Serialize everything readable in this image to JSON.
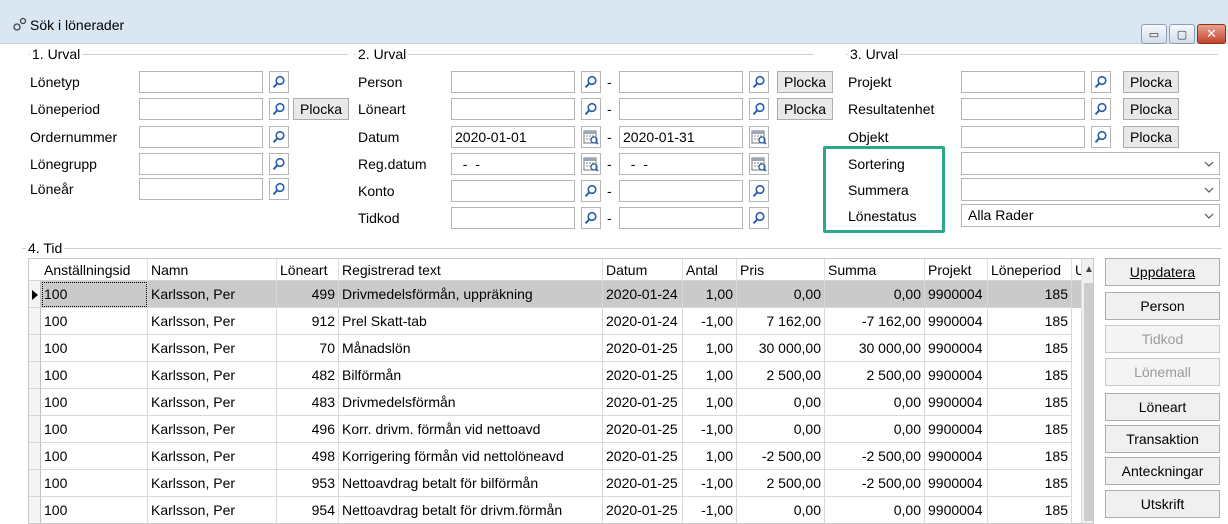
{
  "window": {
    "title": "Sök i lönerader",
    "icon": "users-icon",
    "controls": [
      "minimize-icon",
      "maximize-icon",
      "close-icon"
    ]
  },
  "urval1": {
    "label": "1. Urval",
    "fields": [
      {
        "label": "Lönetyp",
        "value": ""
      },
      {
        "label": "Löneperiod",
        "value": "",
        "pick": "Plocka"
      },
      {
        "label": "Ordernummer",
        "value": ""
      },
      {
        "label": "Lönegrupp",
        "value": ""
      },
      {
        "label": "Löneår",
        "value": ""
      }
    ]
  },
  "urval2": {
    "label": "2. Urval",
    "fields": [
      {
        "label": "Person",
        "from": "",
        "to": "",
        "pick": "Plocka"
      },
      {
        "label": "Löneart",
        "from": "",
        "to": "",
        "pick": "Plocka"
      },
      {
        "label": "Datum",
        "from": "2020-01-01",
        "to": "2020-01-31"
      },
      {
        "label": "Reg.datum",
        "from": "  -  -",
        "to": "  -  -"
      },
      {
        "label": "Konto",
        "from": "",
        "to": ""
      },
      {
        "label": "Tidkod",
        "from": "",
        "to": ""
      }
    ],
    "dash": "-"
  },
  "urval3": {
    "label": "3. Urval",
    "fields": [
      {
        "label": "Projekt",
        "value": "",
        "pick": "Plocka"
      },
      {
        "label": "Resultatenhet",
        "value": "",
        "pick": "Plocka"
      },
      {
        "label": "Objekt",
        "value": "",
        "pick": "Plocka"
      }
    ],
    "combos": [
      {
        "label": "Sortering",
        "value": ""
      },
      {
        "label": "Summera",
        "value": ""
      },
      {
        "label": "Lönestatus",
        "value": "Alla Rader"
      }
    ]
  },
  "tid": {
    "label": "4. Tid",
    "columns": [
      "Anställningsid",
      "Namn",
      "Löneart",
      "Registrerad text",
      "Datum",
      "Antal",
      "Pris",
      "Summa",
      "Projekt",
      "Löneperiod",
      "U"
    ],
    "rows": [
      [
        "100",
        "Karlsson, Per",
        "499",
        "Drivmedelsförmån, uppräkning",
        "2020-01-24",
        "1,00",
        "0,00",
        "0,00",
        "9900004",
        "185"
      ],
      [
        "100",
        "Karlsson, Per",
        "912",
        "Prel Skatt-tab",
        "2020-01-24",
        "-1,00",
        "7 162,00",
        "-7 162,00",
        "9900004",
        "185"
      ],
      [
        "100",
        "Karlsson, Per",
        "70",
        "Månadslön",
        "2020-01-25",
        "1,00",
        "30 000,00",
        "30 000,00",
        "9900004",
        "185"
      ],
      [
        "100",
        "Karlsson, Per",
        "482",
        "Bilförmån",
        "2020-01-25",
        "1,00",
        "2 500,00",
        "2 500,00",
        "9900004",
        "185"
      ],
      [
        "100",
        "Karlsson, Per",
        "483",
        "Drivmedelsförmån",
        "2020-01-25",
        "1,00",
        "0,00",
        "0,00",
        "9900004",
        "185"
      ],
      [
        "100",
        "Karlsson, Per",
        "496",
        "Korr. drivm. förmån vid nettoavd",
        "2020-01-25",
        "-1,00",
        "0,00",
        "0,00",
        "9900004",
        "185"
      ],
      [
        "100",
        "Karlsson, Per",
        "498",
        "Korrigering förmån vid nettolöneavd",
        "2020-01-25",
        "1,00",
        "-2 500,00",
        "-2 500,00",
        "9900004",
        "185"
      ],
      [
        "100",
        "Karlsson, Per",
        "953",
        "Nettoavdrag betalt för bilförmån",
        "2020-01-25",
        "-1,00",
        "2 500,00",
        "-2 500,00",
        "9900004",
        "185"
      ],
      [
        "100",
        "Karlsson, Per",
        "954",
        "Nettoavdrag betalt för drivm.förmån",
        "2020-01-25",
        "-1,00",
        "0,00",
        "0,00",
        "9900004",
        "185"
      ]
    ]
  },
  "buttons": [
    {
      "label": "Uppdatera",
      "enabled": true
    },
    {
      "label": "Person",
      "enabled": true
    },
    {
      "label": "Tidkod",
      "enabled": false
    },
    {
      "label": "Lönemall",
      "enabled": false
    },
    {
      "label": "Löneart",
      "enabled": true
    },
    {
      "label": "Transaktion",
      "enabled": true
    },
    {
      "label": "Anteckningar",
      "enabled": true
    },
    {
      "label": "Utskrift",
      "enabled": true
    }
  ],
  "colors": {
    "highlight": "#2aa98c",
    "selected_row": "#cacaca",
    "titlebar": "#dbe6f3"
  }
}
